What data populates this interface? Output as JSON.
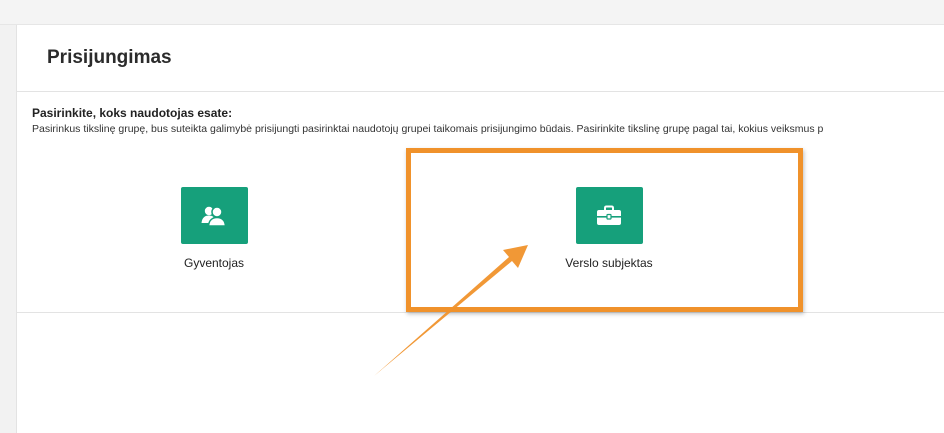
{
  "page": {
    "title": "Prisijungimas"
  },
  "intro": {
    "heading": "Pasirinkite, koks naudotojas esate:",
    "text": "Pasirinkus tikslinę grupę, bus suteikta galimybė prisijungti pasirinktai naudotojų grupei taikomais prisijungimo būdais. Pasirinkite tikslinę grupę pagal tai, kokius veiksmus p"
  },
  "choices": [
    {
      "label": "Gyventojas",
      "icon": "people-icon"
    },
    {
      "label": "Verslo subjektas",
      "icon": "briefcase-icon"
    }
  ],
  "colors": {
    "tile": "#16a07b",
    "highlight": "#f0922b"
  }
}
